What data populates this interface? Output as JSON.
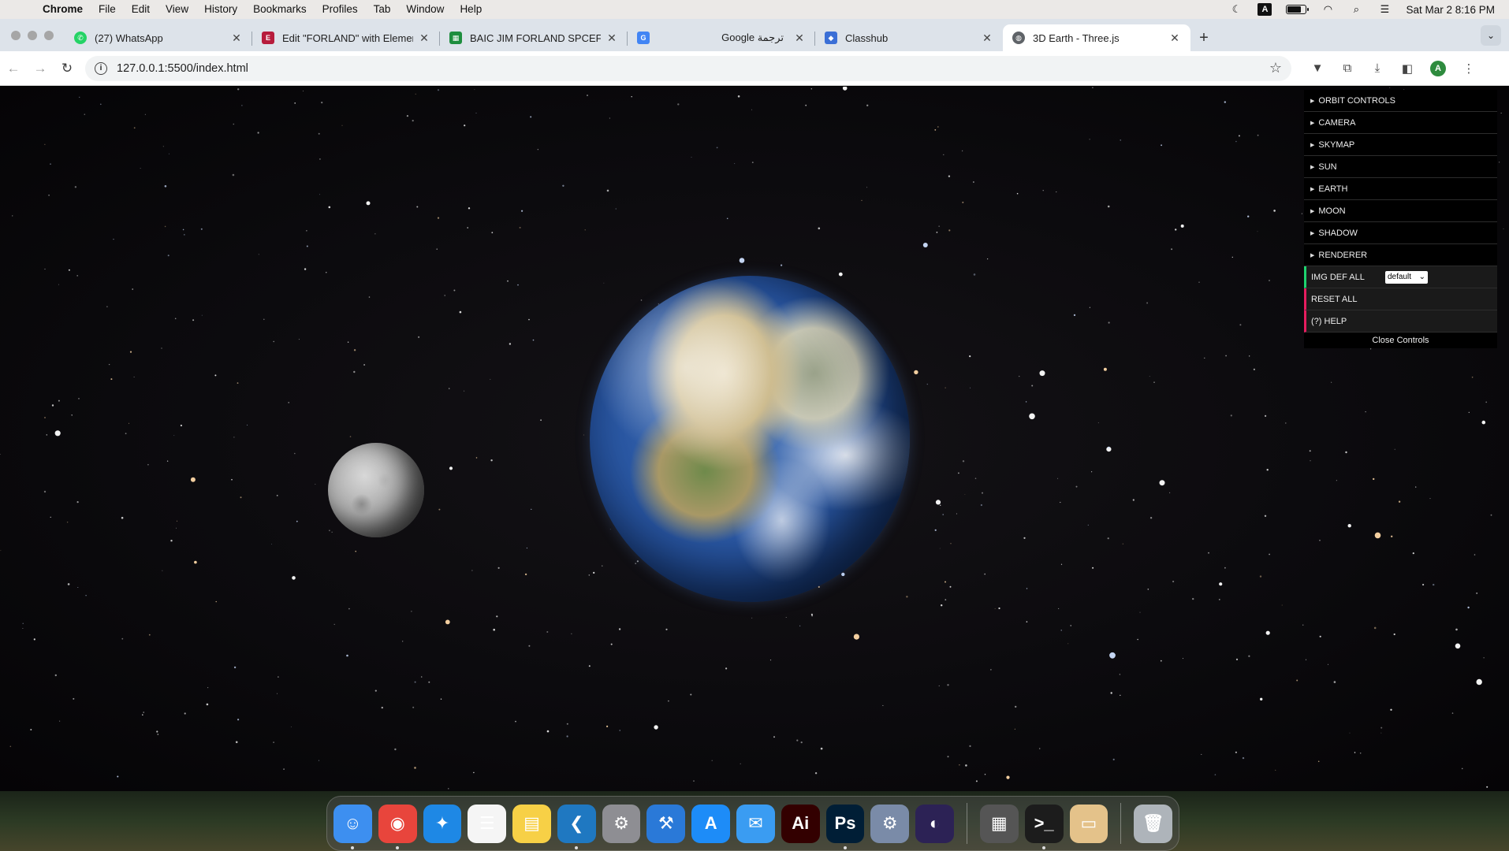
{
  "menubar": {
    "app": "Chrome",
    "items": [
      "File",
      "Edit",
      "View",
      "History",
      "Bookmarks",
      "Profiles",
      "Tab",
      "Window",
      "Help"
    ],
    "clock": "Sat Mar 2  8:16 PM",
    "keyboard_indicator": "A"
  },
  "tabs": [
    {
      "title": "(27) WhatsApp",
      "favicon": "whatsapp-icon",
      "color": "#25d366"
    },
    {
      "title": "Edit \"FORLAND\" with Elementor",
      "favicon": "elementor-icon",
      "color": "#b71c3c"
    },
    {
      "title": "BAIC JIM FORLAND SPCEFICATIONS",
      "favicon": "sheets-icon",
      "color": "#1e8e3e"
    },
    {
      "title": "Google ترجمة",
      "favicon": "translate-icon",
      "color": "#4285f4"
    },
    {
      "title": "Classhub",
      "favicon": "classhub-icon",
      "color": "#3b6fd6"
    },
    {
      "title": "3D Earth - Three.js",
      "favicon": "globe-icon",
      "color": "#5f6368"
    }
  ],
  "omnibox": {
    "url": "127.0.0.1:5500/index.html"
  },
  "profile_initial": "A",
  "gui": {
    "folders": [
      "ORBIT CONTROLS",
      "CAMERA",
      "SKYMAP",
      "SUN",
      "EARTH",
      "MOON",
      "SHADOW",
      "RENDERER"
    ],
    "img_def_label": "IMG DEF ALL",
    "img_def_value": "default",
    "reset_label": "RESET ALL",
    "help_label": "(?) HELP",
    "close_label": "Close Controls"
  },
  "dock": {
    "apps": [
      {
        "name": "finder-icon",
        "color": "#3d8ff0",
        "glyph": "☺",
        "running": true
      },
      {
        "name": "chrome-icon",
        "color": "#e8453c",
        "glyph": "◉",
        "running": true
      },
      {
        "name": "safari-icon",
        "color": "#1e88e5",
        "glyph": "✦",
        "running": false
      },
      {
        "name": "reminders-icon",
        "color": "#f5f5f5",
        "glyph": "☰",
        "running": false
      },
      {
        "name": "notes-icon",
        "color": "#f7d046",
        "glyph": "▤",
        "running": false
      },
      {
        "name": "vscode-icon",
        "color": "#1f78c1",
        "glyph": "❮",
        "running": true
      },
      {
        "name": "system-settings-icon",
        "color": "#8e8e93",
        "glyph": "⚙",
        "running": false
      },
      {
        "name": "xcode-icon",
        "color": "#2a79d8",
        "glyph": "⚒",
        "running": false
      },
      {
        "name": "app-store-icon",
        "color": "#1d8cf8",
        "glyph": "A",
        "running": false
      },
      {
        "name": "mail-icon",
        "color": "#3a9cf2",
        "glyph": "✉",
        "running": false
      },
      {
        "name": "illustrator-icon",
        "color": "#330000",
        "glyph": "Ai",
        "running": false
      },
      {
        "name": "photoshop-icon",
        "color": "#001e36",
        "glyph": "Ps",
        "running": true
      },
      {
        "name": "utility-gear-icon",
        "color": "#7a8ba8",
        "glyph": "⚙",
        "running": false
      },
      {
        "name": "eclipse-icon",
        "color": "#2c2255",
        "glyph": "◐",
        "running": false
      }
    ],
    "apps_right": [
      {
        "name": "calculator-icon",
        "color": "#555",
        "glyph": "▦",
        "running": false
      },
      {
        "name": "terminal-icon",
        "color": "#1c1c1c",
        "glyph": ">_",
        "running": true
      },
      {
        "name": "archive-icon",
        "color": "#e4c28a",
        "glyph": "▭",
        "running": false
      }
    ],
    "trash": {
      "name": "trash-icon",
      "color": "#aeb4ba",
      "glyph": "🗑"
    }
  }
}
